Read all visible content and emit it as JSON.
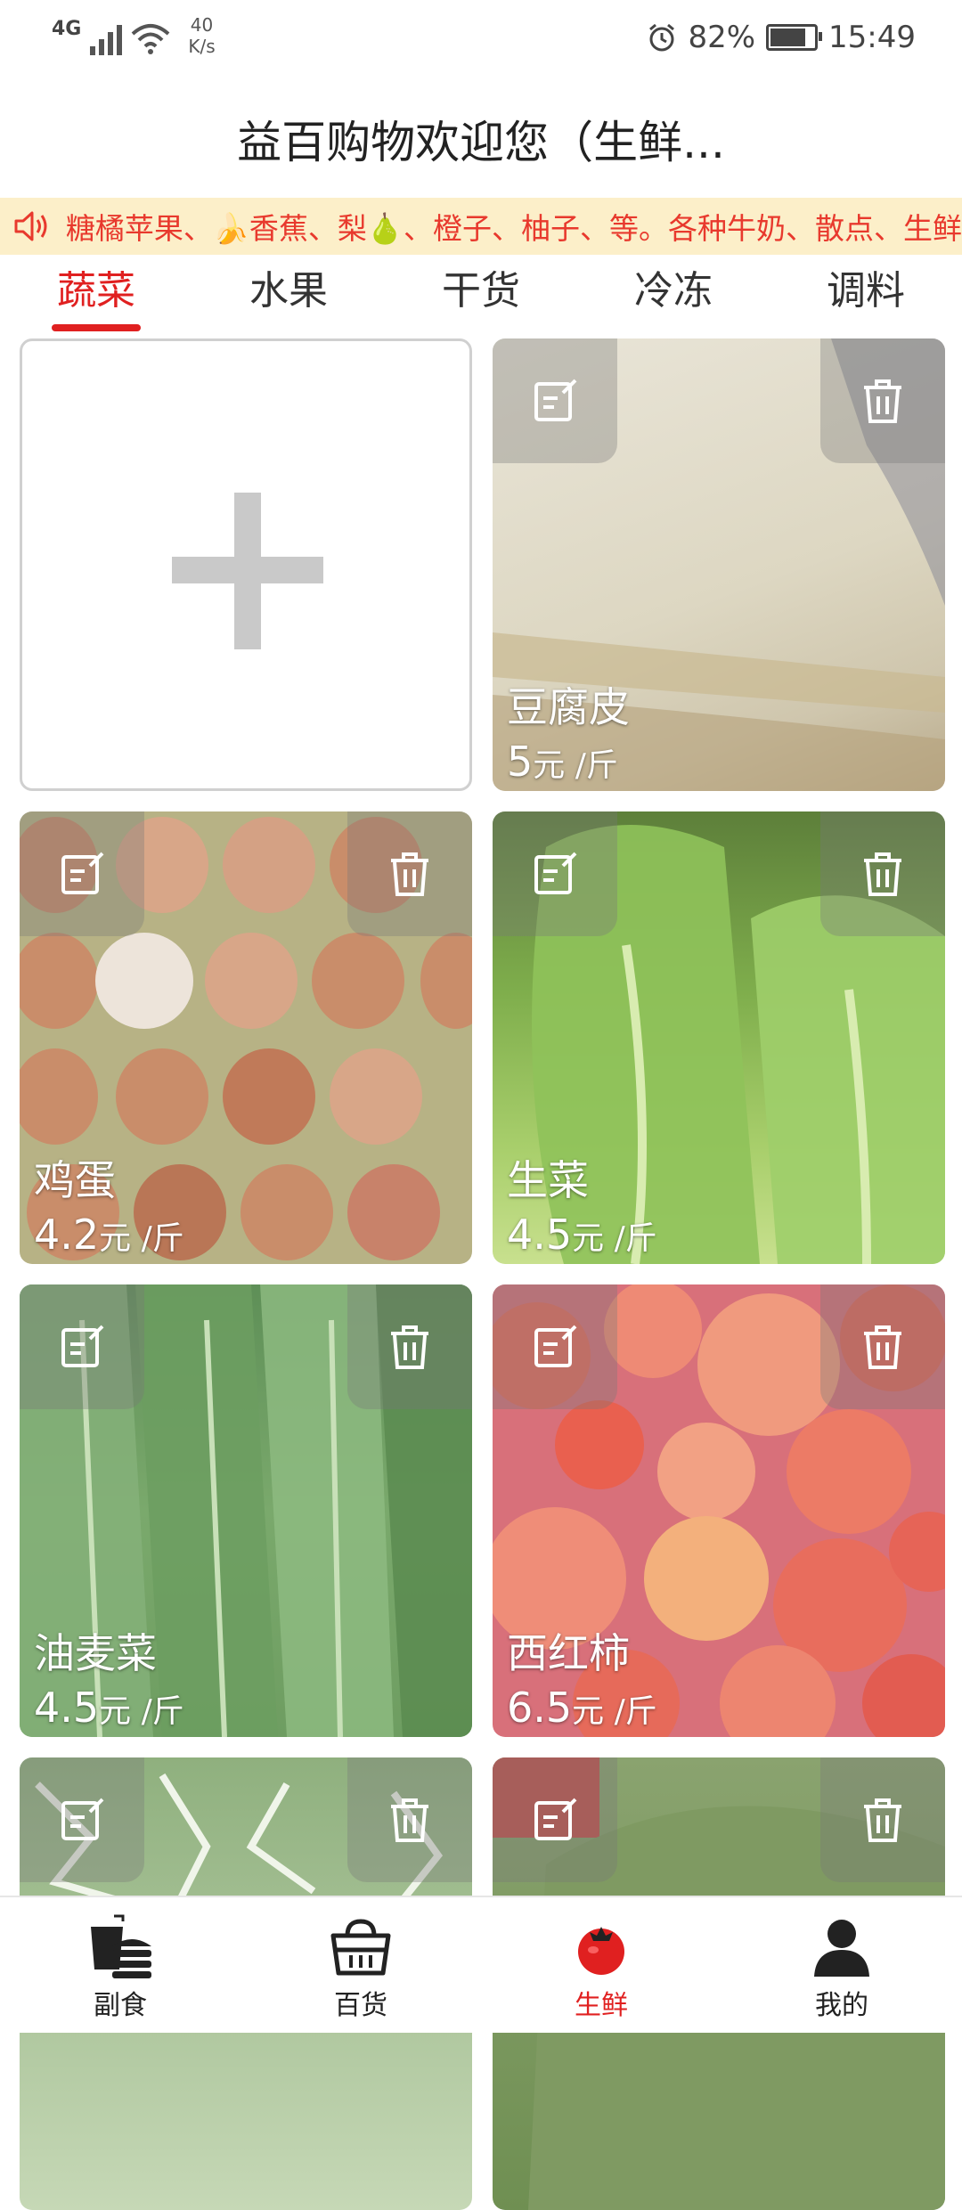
{
  "status_bar": {
    "network": "4G",
    "speed_value": "40",
    "speed_unit": "K/s",
    "battery": "82%",
    "battery_level": 0.82,
    "time": "15:49"
  },
  "title": "益百购物欢迎您（生鲜...",
  "notice": {
    "text": "糖橘苹果、🍌香蕉、梨🍐、橙子、柚子、等。各种牛奶、散点、生鲜"
  },
  "tabs": [
    {
      "label": "蔬菜",
      "active": true
    },
    {
      "label": "水果",
      "active": false
    },
    {
      "label": "干货",
      "active": false
    },
    {
      "label": "冷冻",
      "active": false
    },
    {
      "label": "调料",
      "active": false
    }
  ],
  "products": [
    {
      "name": "豆腐皮",
      "price": "5",
      "unit": "元 /斤"
    },
    {
      "name": "鸡蛋",
      "price": "4.2",
      "unit": "元 /斤"
    },
    {
      "name": "生菜",
      "price": "4.5",
      "unit": "元 /斤"
    },
    {
      "name": "油麦菜",
      "price": "4.5",
      "unit": "元 /斤"
    },
    {
      "name": "西红柿",
      "price": "6.5",
      "unit": "元 /斤"
    },
    {
      "name": "",
      "price": "",
      "unit": ""
    },
    {
      "name": "",
      "price": "",
      "unit": ""
    }
  ],
  "bottom_nav": [
    {
      "label": "副食",
      "icon": "fast-food-icon",
      "active": false
    },
    {
      "label": "百货",
      "icon": "basket-icon",
      "active": false
    },
    {
      "label": "生鲜",
      "icon": "tomato-icon",
      "active": true
    },
    {
      "label": "我的",
      "icon": "user-icon",
      "active": false
    }
  ],
  "colors": {
    "accent": "#e02020",
    "notice_bg": "#fcefc9",
    "notice_text": "#e8392d"
  }
}
